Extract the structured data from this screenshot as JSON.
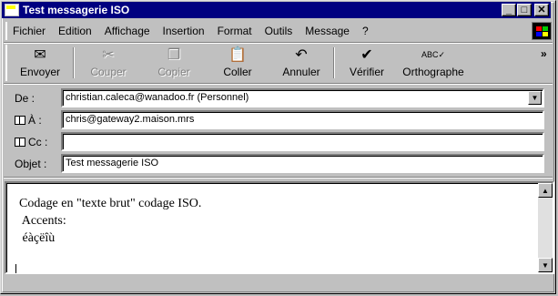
{
  "window": {
    "title": "Test messagerie ISO"
  },
  "titlebar": {
    "min": "_",
    "max": "□",
    "close": "✕"
  },
  "menu": [
    {
      "label": "Fichier"
    },
    {
      "label": "Edition"
    },
    {
      "label": "Affichage"
    },
    {
      "label": "Insertion"
    },
    {
      "label": "Format"
    },
    {
      "label": "Outils"
    },
    {
      "label": "Message"
    },
    {
      "label": "?"
    }
  ],
  "toolbar": {
    "send": "Envoyer",
    "cut": "Couper",
    "copy": "Copier",
    "paste": "Coller",
    "undo": "Annuler",
    "check": "Vérifier",
    "spell": "Orthographe",
    "more": "»"
  },
  "fields": {
    "from_label": "De :",
    "from_value": "christian.caleca@wanadoo.fr    (Personnel)",
    "to_label": "À :",
    "to_value": "chris@gateway2.maison.mrs",
    "cc_label": "Cc :",
    "cc_value": "",
    "subject_label": "Objet :",
    "subject_value": "Test messagerie ISO"
  },
  "body": {
    "line1": "Codage en \"texte brut\" codage ISO.",
    "line2": " Accents:",
    "line3": " éàçëîù"
  }
}
